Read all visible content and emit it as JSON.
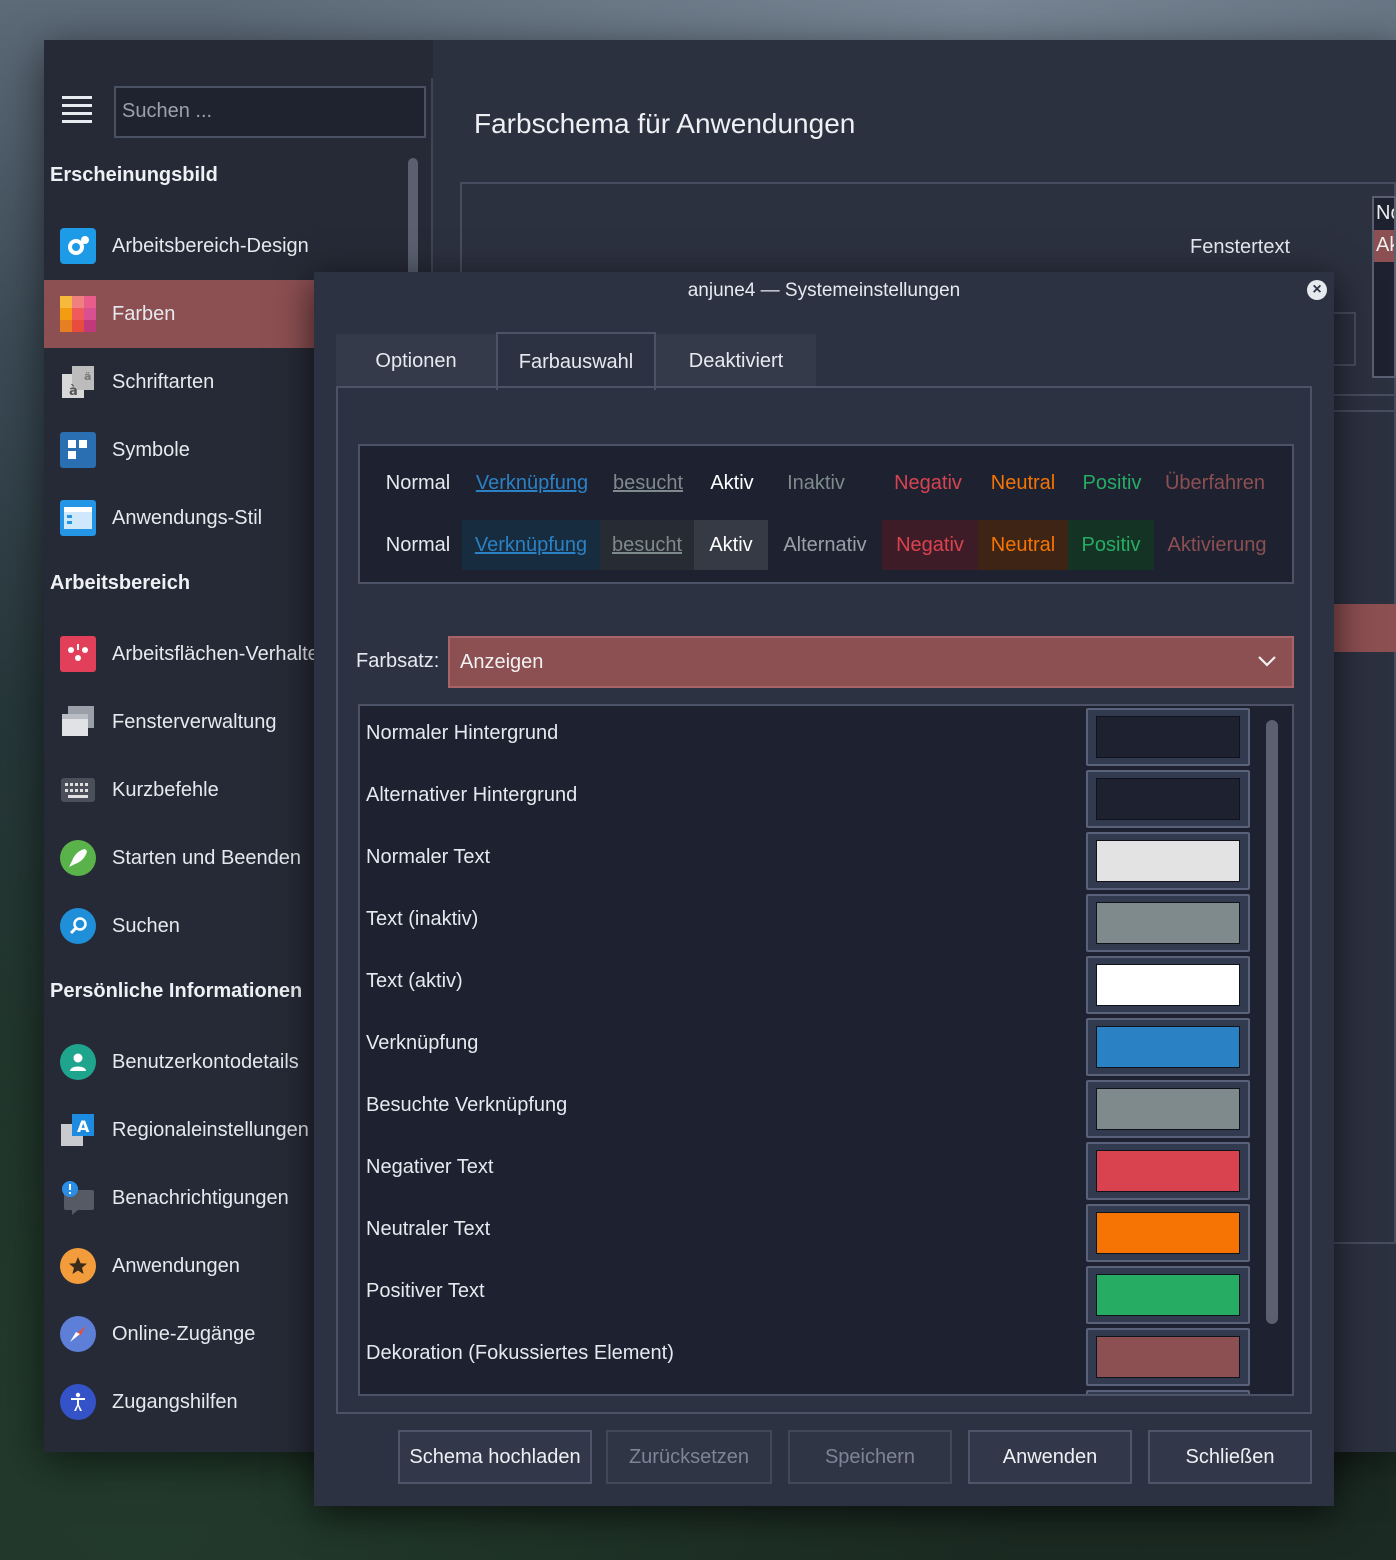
{
  "main": {
    "search_placeholder": "Suchen ...",
    "page_title": "Farbschema für Anwendungen",
    "bg_label": "Fenstertext",
    "bg_list": [
      "Normal",
      "Aktiv"
    ],
    "sidebar": {
      "sections": [
        {
          "title": "Erscheinungsbild",
          "items": [
            {
              "label": "Arbeitsbereich-Design",
              "icon": "desktop-theme-icon"
            },
            {
              "label": "Farben",
              "icon": "colors-icon",
              "active": true
            },
            {
              "label": "Schriftarten",
              "icon": "fonts-icon"
            },
            {
              "label": "Symbole",
              "icon": "icons-icon"
            },
            {
              "label": "Anwendungs-Stil",
              "icon": "application-style-icon"
            }
          ]
        },
        {
          "title": "Arbeitsbereich",
          "items": [
            {
              "label": "Arbeitsflächen-Verhalten",
              "icon": "desktop-behavior-icon"
            },
            {
              "label": "Fensterverwaltung",
              "icon": "window-management-icon"
            },
            {
              "label": "Kurzbefehle",
              "icon": "keyboard-icon"
            },
            {
              "label": "Starten und Beenden",
              "icon": "rocket-icon"
            },
            {
              "label": "Suchen",
              "icon": "search-icon"
            }
          ]
        },
        {
          "title": "Persönliche Informationen",
          "items": [
            {
              "label": "Benutzerkontodetails",
              "icon": "user-icon"
            },
            {
              "label": "Regionaleinstellungen",
              "icon": "locale-icon"
            },
            {
              "label": "Benachrichtigungen",
              "icon": "notifications-icon"
            },
            {
              "label": "Anwendungen",
              "icon": "star-icon"
            },
            {
              "label": "Online-Zugänge",
              "icon": "compass-icon"
            },
            {
              "label": "Zugangshilfen",
              "icon": "accessibility-icon"
            }
          ]
        }
      ]
    }
  },
  "dialog": {
    "title": "anjune4 — Systemeinstellungen",
    "tabs": [
      "Optionen",
      "Farbauswahl",
      "Deaktiviert"
    ],
    "selected_tab": "Farbauswahl",
    "preview": {
      "row1": [
        "Normal",
        "Verknüpfung",
        "besucht",
        "Aktiv",
        "Inaktiv",
        "Negativ",
        "Neutral",
        "Positiv",
        "Überfahren"
      ],
      "row2": [
        "Normal",
        "Verknüpfung",
        "besucht",
        "Aktiv",
        "Alternativ",
        "Negativ",
        "Neutral",
        "Positiv",
        "Aktivierung"
      ]
    },
    "colorset_label": "Farbsatz:",
    "colorset_value": "Anzeigen",
    "colors": [
      {
        "label": "Normaler Hintergrund",
        "color": "#1d2130"
      },
      {
        "label": "Alternativer Hintergrund",
        "color": "#1d2130"
      },
      {
        "label": "Normaler Text",
        "color": "#e3e3e3"
      },
      {
        "label": "Text (inaktiv)",
        "color": "#7e8a8b"
      },
      {
        "label": "Text (aktiv)",
        "color": "#ffffff"
      },
      {
        "label": "Verknüpfung",
        "color": "#2a81c4"
      },
      {
        "label": "Besuchte Verknüpfung",
        "color": "#7e8a8b"
      },
      {
        "label": "Negativer Text",
        "color": "#d9434f"
      },
      {
        "label": "Neutraler Text",
        "color": "#f67403"
      },
      {
        "label": "Positiver Text",
        "color": "#26ad63"
      },
      {
        "label": "Dekoration (Fokussiertes Element)",
        "color": "#8c4f52"
      }
    ],
    "buttons": {
      "upload": "Schema hochladen",
      "reset": "Zurücksetzen",
      "save": "Speichern",
      "apply": "Anwenden",
      "close": "Schließen"
    }
  },
  "colors": {
    "accent": "#8c4f52",
    "link": "#2a81c4",
    "negative": "#d9434f",
    "neutral": "#f67403",
    "positive": "#26ad63",
    "inactive": "#7e8a8b"
  }
}
